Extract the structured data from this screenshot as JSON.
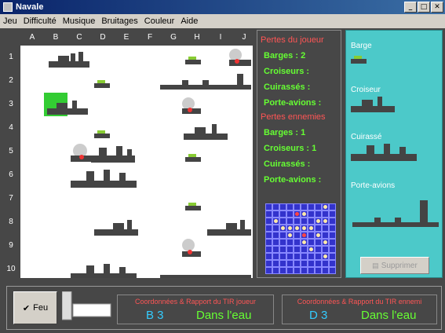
{
  "window": {
    "title": "Navale"
  },
  "menu": [
    "Jeu",
    "Difficulté",
    "Musique",
    "Bruitages",
    "Couleur",
    "Aide"
  ],
  "grid": {
    "columns": [
      "A",
      "B",
      "C",
      "D",
      "E",
      "F",
      "G",
      "H",
      "I",
      "J"
    ],
    "rows": [
      "1",
      "2",
      "3",
      "4",
      "5",
      "6",
      "7",
      "8",
      "9",
      "10"
    ]
  },
  "stats": {
    "player_heading": "Pertes du joueur",
    "enemy_heading": "Pertes ennemies",
    "player_rows": [
      "Barges : 2",
      "Croiseurs :",
      "Cuirassés :",
      "Porte-avions :"
    ],
    "enemy_rows": [
      "Barges : 1",
      "Croiseurs : 1",
      "Cuirassés :",
      "Porte-avions :"
    ]
  },
  "ships_panel": {
    "barge": "Barge",
    "croiseur": "Croiseur",
    "cuirasse": "Cuirassé",
    "porte_avions": "Porte-avions",
    "supprimer": "Supprimer"
  },
  "bottom": {
    "feu_label": "Feu",
    "player_report_title": "Coordonnées & Rapport du TIR joueur",
    "player_coord": "B 3",
    "player_result": "Dans l'eau",
    "enemy_report_title": "Coordonnées & Rapport du TIR ennemi",
    "enemy_coord": "D 3",
    "enemy_result": "Dans l'eau"
  },
  "colors": {
    "barge": "#88cc33",
    "ship": "#444444",
    "highlight": "#33cc33"
  }
}
